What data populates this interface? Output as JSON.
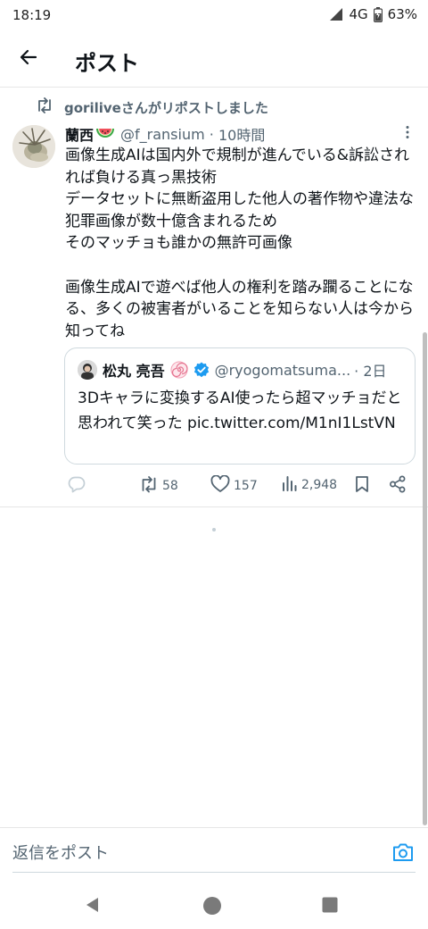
{
  "status_bar": {
    "time": "18:19",
    "network": "4G",
    "battery": "63%"
  },
  "app_bar": {
    "title": "ポスト",
    "back_icon": "arrow-left-icon"
  },
  "repost_notice": {
    "text": "goriliveさんがリポストしました",
    "icon": "repost-icon"
  },
  "post": {
    "author_name": "蘭西",
    "author_emoji": "watermelon",
    "handle": "@f_ransium",
    "separator": "·",
    "time": "10時間",
    "body": "画像生成AIは国内外で規制が進んでいる&訴訟されれば負ける真っ黒技術\nデータセットに無断盗用した他人の著作物や違法な犯罪画像が数十億含まれるため\nそのマッチョも誰かの無許可画像\n\n画像生成AIで遊べば他人の権利を踏み躙ることになる、多くの被害者がいることを知らない人は今から知ってね"
  },
  "quote": {
    "author_name": "松丸 亮吾",
    "handle": "@ryogomatsuma...",
    "time": "· 2日",
    "text": "3Dキャラに変換するAI使ったら超マッチョだと思われて笑った pic.twitter.com/M1nI1LstVN"
  },
  "actions": {
    "reply_count": "",
    "repost_count": "58",
    "like_count": "157",
    "view_count": "2,948"
  },
  "reply_bar": {
    "placeholder": "返信をポスト"
  },
  "colors": {
    "accent": "#1d9bf0",
    "secondary_text": "#536471",
    "border": "#cfd9de"
  }
}
